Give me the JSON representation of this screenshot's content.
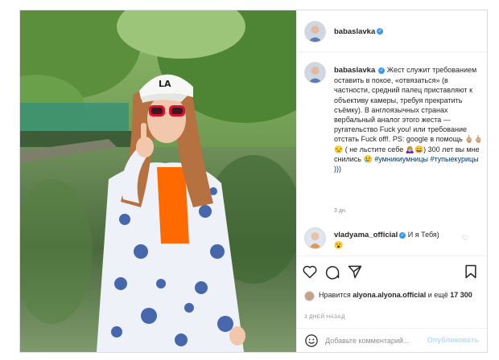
{
  "post": {
    "photo": {
      "cap_logo": "LA",
      "colors": {
        "foliage": "#4c7a3a",
        "shirt": "#ff6a00",
        "kimono_pattern": "#2b4fa0",
        "glasses": "#d8102f"
      }
    },
    "header": {
      "username": "babaslavka",
      "verified_icon": "verified-badge-icon"
    },
    "caption": {
      "username": "babaslavka",
      "text": "Жест служит требованием оставить в покое, «отвязаться» (в частности, средний палец приставляют к объективу камеры, требуя прекратить съёмку). В англоязычных странах вербальный аналог этого жеста — ругательство Fuck you! или требование отстать Fuck off!. PS: google в помощь 🖕🏼🖕🏼😒 ( не льстите себе 🙇🏼‍♀️😄) 300 лет вы мне снились 😢",
      "hashtags": "#умникиумницы #тупыекурицы )))",
      "time": "3 дн."
    },
    "comment": {
      "username": "vladyama_official",
      "text": "И я Тебя)",
      "emoji": "😮"
    },
    "actions": {
      "like_icon": "heart-icon",
      "comment_icon": "comment-bubble-icon",
      "share_icon": "paper-plane-icon",
      "save_icon": "bookmark-icon"
    },
    "likes": {
      "prefix": "Нравится ",
      "user": "alyona.alyona.official",
      "middle": " и ещё ",
      "count": "17 300"
    },
    "time_ago": "3 ДНЕЙ НАЗАД",
    "add_comment": {
      "placeholder": "Добавьте комментарий...",
      "publish_label": "Опубликовать"
    }
  }
}
